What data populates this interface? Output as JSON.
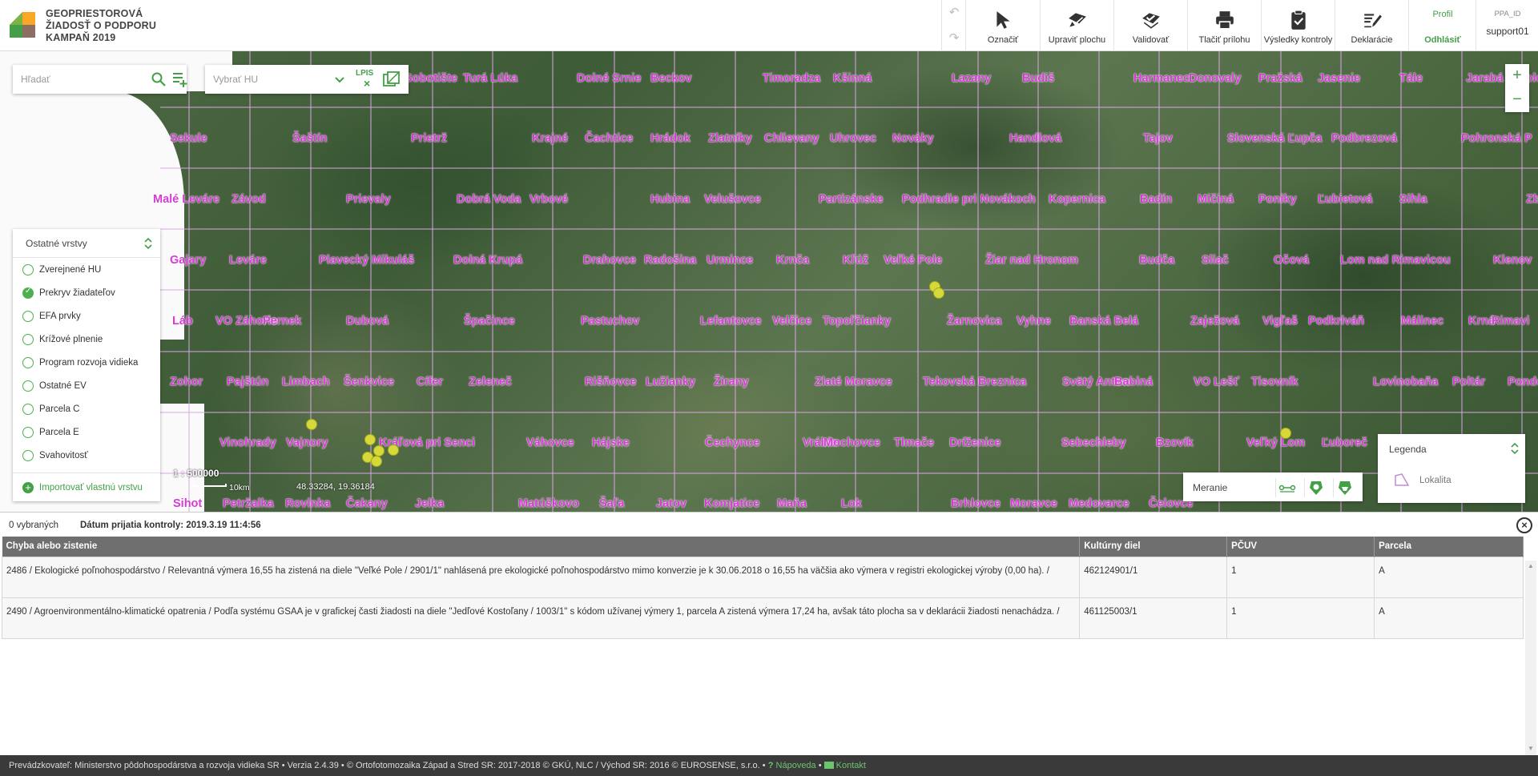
{
  "app": {
    "title_lines": [
      "GEOPRIESTOROVÁ",
      "ŽIADOSŤ O PODPORU",
      "KAMPAŇ 2019"
    ]
  },
  "toolbar": {
    "undo_icon": "undo-icon",
    "redo_icon": "redo-icon",
    "items": [
      {
        "label": "Označiť",
        "icon": "cursor-icon"
      },
      {
        "label": "Upraviť plochu",
        "icon": "edit-area-icon"
      },
      {
        "label": "Validovať",
        "icon": "validate-icon"
      },
      {
        "label": "Tlačiť prílohu",
        "icon": "print-icon"
      },
      {
        "label": "Výsledky kontroly",
        "icon": "clipboard-check-icon"
      },
      {
        "label": "Deklarácie",
        "icon": "declaration-icon"
      }
    ],
    "profile_label": "Profil",
    "logout_label": "Odhlásiť",
    "ppa_label": "PPA_ID",
    "user": "support01"
  },
  "map": {
    "search_placeholder": "Hľadať",
    "hu_placeholder": "Vybrať HU",
    "lpis_label": "LPIS",
    "zoom_in": "+",
    "zoom_out": "−",
    "towns": [
      "Sobotište",
      "Turá Lúka",
      "Dolné Srnie",
      "Beckov",
      "Timoradza",
      "Kšinná",
      "Lazany",
      "Budiš",
      "Harmanec",
      "Donovaly",
      "Pražská",
      "Jasenie",
      "Tále",
      "Jarabá",
      "Polom",
      "Sekule",
      "Šaštín",
      "Prietrž",
      "Krajné",
      "Čachtice",
      "Hrádok",
      "Zlatníky",
      "Chlievany",
      "Uhrovec",
      "Nováky",
      "Handlová",
      "Tajov",
      "Slovenská Ľupča",
      "Podbrezová",
      "Pohronská P",
      "Malé Leváre",
      "Závod",
      "Prievaly",
      "Dobrá Voda",
      "Vrbové",
      "Hubina",
      "Velušovce",
      "Partizánske",
      "Podhradie pri Novákoch",
      "Kopernica",
      "Badín",
      "Mičiná",
      "Poniky",
      "Ľubietová",
      "Sihla",
      "Zbojsk",
      "Gajary",
      "Leváre",
      "Plavecký Mikuláš",
      "Dolná Krupá",
      "Drahovce",
      "Radošina",
      "Urmince",
      "Krnča",
      "Kľúž",
      "Veľké Pole",
      "Žiar nad Hronom",
      "Budča",
      "Sliač",
      "Očová",
      "Lom nad Rimavicou",
      "Klenov",
      "Láb",
      "VO Záhorie",
      "Pernek",
      "Dubová",
      "Špačince",
      "Pastuchov",
      "Lefantovce",
      "Velčice",
      "Topoľčianky",
      "Žarnovica",
      "Vyhne",
      "Banská Belá",
      "Zaježová",
      "Vigľaš",
      "Podkriváň",
      "Málinec",
      "Krná",
      "Rimavi",
      "Zohor",
      "Pajštún",
      "Limbach",
      "Šenkvice",
      "Cífer",
      "Zeleneč",
      "Rišňovce",
      "Lužianky",
      "Žirany",
      "Zlaté Moravce",
      "Tekovská Breznica",
      "Svätý Anton",
      "Babiná",
      "VO Lešť",
      "Tisovník",
      "Lovinobaňa",
      "Poltár",
      "Pondelo",
      "Vinohrady",
      "Vajnory",
      "Kráľová pri Senci",
      "Váhovce",
      "Hájske",
      "Čechynce",
      "Vráble",
      "Mochovce",
      "Tlmače",
      "Dríženice",
      "Sebechleby",
      "Bzovík",
      "Veľký Lom",
      "Ľuboreč",
      "Sihot",
      "Petržalka",
      "Rovinka",
      "Čakany",
      "Jelka",
      "Matúškovo",
      "Šaľa",
      "Jatov",
      "Komjatice",
      "Maňa",
      "Lok",
      "Brhlovce",
      "Moravce",
      "Medovarce",
      "Čelovce"
    ],
    "layers_title": "Ostatné vrstvy",
    "layers": [
      {
        "label": "Zverejnené HU",
        "checked": false
      },
      {
        "label": "Prekryv žiadateľov",
        "checked": true
      },
      {
        "label": "EFA prvky",
        "checked": false
      },
      {
        "label": "Krížové plnenie",
        "checked": false
      },
      {
        "label": "Program rozvoja vidieka",
        "checked": false
      },
      {
        "label": "Ostatné EV",
        "checked": false
      },
      {
        "label": "Parcela C",
        "checked": false
      },
      {
        "label": "Parcela E",
        "checked": false
      },
      {
        "label": "Svahovitosť",
        "checked": false
      }
    ],
    "import_layer_label": "Importovať vlastnú vrstvu",
    "scale": "1 : 500000",
    "scale_km": "10km",
    "coordinates": "48.33284, 19.36184",
    "measure_label": "Meranie",
    "legend_title": "Legenda",
    "legend_item": "Lokalita",
    "accent_color": "#43a047",
    "town_color": "#d63bd6",
    "marker_color": "#d6d93a"
  },
  "results": {
    "selected_count": "0 vybraných",
    "received_date": "Dátum prijatia kontroly: 2019.3.19 11:4:56",
    "columns": [
      "Chyba alebo zistenie",
      "Kultúrny diel",
      "PČUV",
      "Parcela"
    ],
    "rows": [
      {
        "message": "2486 / Ekologické poľnohospodárstvo / Relevantná výmera 16,55 ha zistená na diele \"Veľké Pole / 2901/1\" nahlásená pre ekologické poľnohospodárstvo mimo konverzie je k 30.06.2018 o 16,55 ha väčšia ako výmera v registri ekologickej výroby (0,00 ha). /",
        "block": "462124901/1",
        "pcuv": "1",
        "parcel": "A"
      },
      {
        "message": "2490 / Agroenvironmentálno-klimatické opatrenia / Podľa systému GSAA je v grafickej časti žiadosti na diele \"Jedľové Kostoľany / 1003/1\" s kódom užívanej výmery 1, parcela A zistená výmera 17,24 ha, avšak táto plocha sa v deklarácii žiadosti nenachádza. /",
        "block": "461125003/1",
        "pcuv": "1",
        "parcel": "A"
      }
    ]
  },
  "footer": {
    "operator": "Prevádzkovateľ: Ministerstvo pôdohospodárstva a rozvoja vidieka SR",
    "version": "Verzia 2.4.39",
    "copyright": "© Ortofotomozaika Západ a Stred SR: 2017-2018 © GKÚ, NLC / Východ SR: 2016 © EUROSENSE, s.r.o.",
    "help_label": "Nápoveda",
    "contact_label": "Kontakt"
  }
}
